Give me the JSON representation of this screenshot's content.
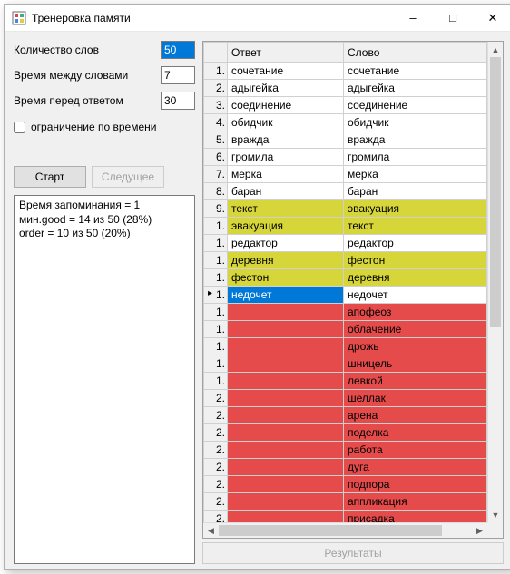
{
  "window": {
    "title": "Тренеровка памяти"
  },
  "form": {
    "word_count_label": "Количество слов",
    "word_count_value": "50",
    "interval_label": "Время между словами",
    "interval_value": "7",
    "pre_answer_label": "Время перед ответом",
    "pre_answer_value": "30",
    "time_limit_label": "ограничение по времени",
    "time_limit_checked": false
  },
  "buttons": {
    "start": "Старт",
    "next": "Следущее",
    "results": "Результаты"
  },
  "stats_text": "Время запоминания = 1\nмин.good = 14 из 50 (28%)\norder = 10 из 50 (20%)",
  "grid": {
    "columns": {
      "answer": "Ответ",
      "word": "Слово"
    },
    "rows": [
      {
        "n": "1.",
        "answer": "сочетание",
        "word": "сочетание",
        "state": "ok"
      },
      {
        "n": "2.",
        "answer": "адыгейка",
        "word": "адыгейка",
        "state": "ok"
      },
      {
        "n": "3.",
        "answer": "соединение",
        "word": "соединение",
        "state": "ok"
      },
      {
        "n": "4.",
        "answer": "обидчик",
        "word": "обидчик",
        "state": "ok"
      },
      {
        "n": "5.",
        "answer": "вражда",
        "word": "вражда",
        "state": "ok"
      },
      {
        "n": "6.",
        "answer": "громила",
        "word": "громила",
        "state": "ok"
      },
      {
        "n": "7.",
        "answer": "мерка",
        "word": "мерка",
        "state": "ok"
      },
      {
        "n": "8.",
        "answer": "баран",
        "word": "баран",
        "state": "ok"
      },
      {
        "n": "9.",
        "answer": "текст",
        "word": "эвакуация",
        "state": "swap"
      },
      {
        "n": "1.",
        "answer": "эвакуация",
        "word": "текст",
        "state": "swap"
      },
      {
        "n": "1.",
        "answer": "редактор",
        "word": "редактор",
        "state": "ok"
      },
      {
        "n": "1.",
        "answer": "деревня",
        "word": "фестон",
        "state": "swap"
      },
      {
        "n": "1.",
        "answer": "фестон",
        "word": "деревня",
        "state": "swap"
      },
      {
        "n": "1.",
        "answer": "недочет",
        "word": "недочет",
        "state": "current"
      },
      {
        "n": "1.",
        "answer": "",
        "word": "апофеоз",
        "state": "miss"
      },
      {
        "n": "1.",
        "answer": "",
        "word": "облачение",
        "state": "miss"
      },
      {
        "n": "1.",
        "answer": "",
        "word": "дрожь",
        "state": "miss"
      },
      {
        "n": "1.",
        "answer": "",
        "word": "шницель",
        "state": "miss"
      },
      {
        "n": "1.",
        "answer": "",
        "word": "левкой",
        "state": "miss"
      },
      {
        "n": "2.",
        "answer": "",
        "word": "шеллак",
        "state": "miss"
      },
      {
        "n": "2.",
        "answer": "",
        "word": "арена",
        "state": "miss"
      },
      {
        "n": "2.",
        "answer": "",
        "word": "поделка",
        "state": "miss"
      },
      {
        "n": "2.",
        "answer": "",
        "word": "работа",
        "state": "miss"
      },
      {
        "n": "2.",
        "answer": "",
        "word": "дуга",
        "state": "miss"
      },
      {
        "n": "2.",
        "answer": "",
        "word": "подпора",
        "state": "miss"
      },
      {
        "n": "2.",
        "answer": "",
        "word": "аппликация",
        "state": "miss"
      },
      {
        "n": "2.",
        "answer": "",
        "word": "присадка",
        "state": "miss"
      }
    ]
  }
}
